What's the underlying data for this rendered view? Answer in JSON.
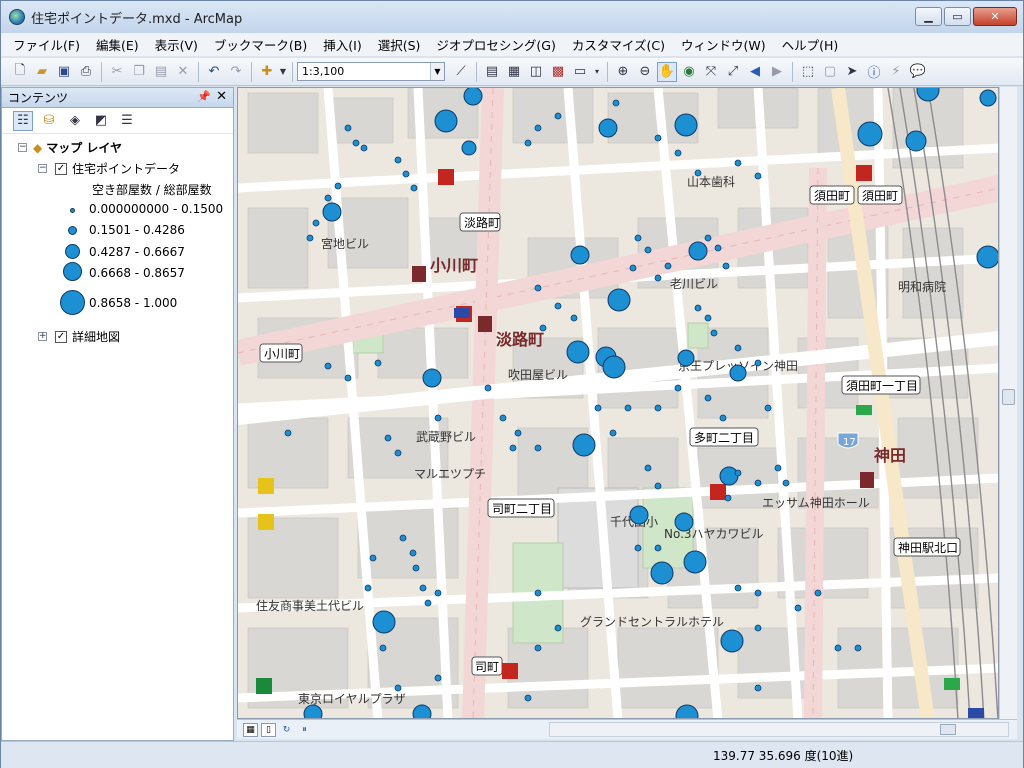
{
  "window": {
    "title": "住宅ポイントデータ.mxd - ArcMap"
  },
  "menu": [
    "ファイル(F)",
    "編集(E)",
    "表示(V)",
    "ブックマーク(B)",
    "挿入(I)",
    "選択(S)",
    "ジオプロセシング(G)",
    "カスタマイズ(C)",
    "ウィンドウ(W)",
    "ヘルプ(H)"
  ],
  "toolbar": {
    "scale": "1:3,100"
  },
  "toc": {
    "title": "コンテンツ",
    "root": "マップ レイヤ",
    "layer1": {
      "name": "住宅ポイントデータ",
      "field": "空き部屋数 / 総部屋数"
    },
    "legend": [
      "0.000000000 - 0.1500",
      "0.1501 - 0.4286",
      "0.4287 - 0.6667",
      "0.6668 - 0.8657",
      "0.8658 - 1.000"
    ],
    "layer2": {
      "name": "詳細地図"
    }
  },
  "map": {
    "labels": {
      "ogawamachi": "小川町",
      "awajicho": "淡路町",
      "kanda": "神田",
      "stop_awajicho": "淡路町",
      "stop_ogawamachi": "小川町",
      "stop_sudacho1": "須田町",
      "stop_sudacho2": "須田町",
      "stop_sudacho1chome": "須田町一丁目",
      "stop_tacho2chome": "多町二丁目",
      "stop_tsukasacho2chome": "司町二丁目",
      "stop_tsukasacho": "司町",
      "stop_kandakitaguchi": "神田駅北口",
      "yamamoto": "山本歯科",
      "miyaji": "宮地ビル",
      "meiwa": "明和病院",
      "oikawa": "老川ビル",
      "suitaya": "吹田屋ビル",
      "keio": "京王プレッソイン神田",
      "musashino": "武蔵野ビル",
      "maruetsu": "マルエツプチ",
      "chiyoda": "千代田小",
      "hayakawa": "No.3ハヤカワビル",
      "essam": "エッサム神田ホール",
      "grand": "グランドセントラルホテル",
      "sumitomo": "住友商事美土代ビル",
      "royal": "東京ロイヤルプラザ",
      "route17": "17"
    }
  },
  "status": {
    "coords": "139.77  35.696 度(10進)"
  },
  "colors": {
    "point_fill": "#1d8fd3",
    "point_stroke": "#0d3a66",
    "road_pink": "#f3d6d6"
  }
}
